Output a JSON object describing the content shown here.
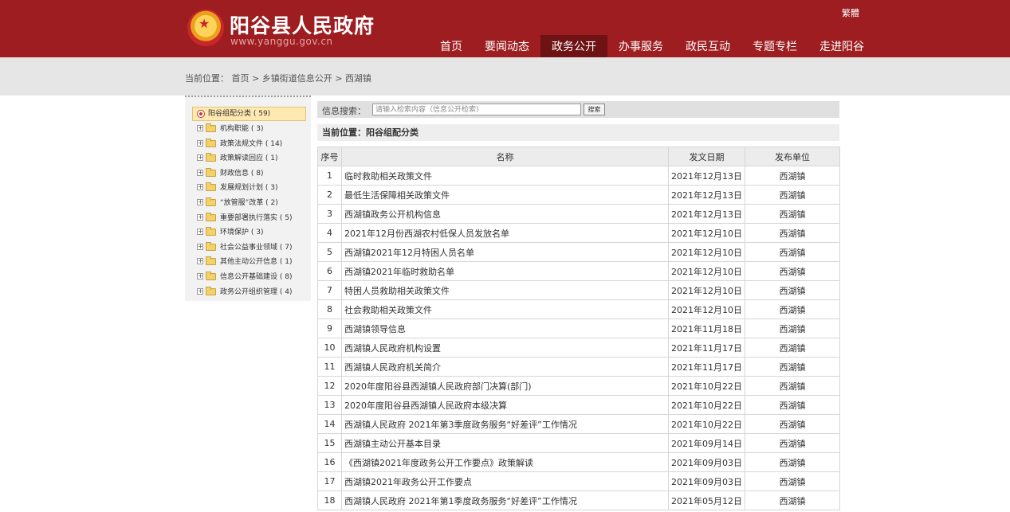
{
  "header": {
    "site_title": "阳谷县人民政府",
    "site_url": "www.yanggu.gov.cn",
    "traditional_link": "繁體",
    "nav": [
      {
        "label": "首页"
      },
      {
        "label": "要闻动态"
      },
      {
        "label": "政务公开",
        "active": true
      },
      {
        "label": "办事服务"
      },
      {
        "label": "政民互动"
      },
      {
        "label": "专题专栏"
      },
      {
        "label": "走进阳谷"
      }
    ]
  },
  "breadcrumb": {
    "prefix": "当前位置：",
    "items": [
      "首页",
      "乡镇街道信息公开",
      "西湖镇"
    ],
    "separator": " > "
  },
  "sidebar": {
    "root": "阳谷组配分类 ( 59)",
    "items": [
      {
        "label": "机构职能 ( 3)"
      },
      {
        "label": "政策法规文件 ( 14)"
      },
      {
        "label": "政策解读回应 ( 1)"
      },
      {
        "label": "财政信息 ( 8)"
      },
      {
        "label": "发展规划计划 ( 3)"
      },
      {
        "label": "“放管服”改革 ( 2)"
      },
      {
        "label": "重要部署执行落实 ( 5)"
      },
      {
        "label": "环境保护 ( 3)"
      },
      {
        "label": "社会公益事业领域 ( 7)"
      },
      {
        "label": "其他主动公开信息 ( 1)"
      },
      {
        "label": "信息公开基础建设 ( 8)"
      },
      {
        "label": "政务公开组织管理 ( 4)"
      }
    ]
  },
  "search": {
    "label": "信息搜索：",
    "placeholder": "请输入检索内容（信息公开检索)",
    "value": "",
    "button_label": "搜索"
  },
  "current_position": "当前位置：阳谷组配分类",
  "table": {
    "headers": [
      "序号",
      "名称",
      "发文日期",
      "发布单位"
    ],
    "rows": [
      {
        "num": "1",
        "title": "临时救助相关政策文件",
        "date": "2021年12月13日",
        "unit": "西湖镇"
      },
      {
        "num": "2",
        "title": "最低生活保障相关政策文件",
        "date": "2021年12月13日",
        "unit": "西湖镇"
      },
      {
        "num": "3",
        "title": "西湖镇政务公开机构信息",
        "date": "2021年12月13日",
        "unit": "西湖镇"
      },
      {
        "num": "4",
        "title": "2021年12月份西湖农村低保人员发放名单",
        "date": "2021年12月10日",
        "unit": "西湖镇"
      },
      {
        "num": "5",
        "title": "西湖镇2021年12月特困人员名单",
        "date": "2021年12月10日",
        "unit": "西湖镇"
      },
      {
        "num": "6",
        "title": "西湖镇2021年临时救助名单",
        "date": "2021年12月10日",
        "unit": "西湖镇"
      },
      {
        "num": "7",
        "title": "特困人员救助相关政策文件",
        "date": "2021年12月10日",
        "unit": "西湖镇"
      },
      {
        "num": "8",
        "title": "社会救助相关政策文件",
        "date": "2021年12月10日",
        "unit": "西湖镇"
      },
      {
        "num": "9",
        "title": "西湖镇领导信息",
        "date": "2021年11月18日",
        "unit": "西湖镇"
      },
      {
        "num": "10",
        "title": "西湖镇人民政府机构设置",
        "date": "2021年11月17日",
        "unit": "西湖镇"
      },
      {
        "num": "11",
        "title": "西湖镇人民政府机关简介",
        "date": "2021年11月17日",
        "unit": "西湖镇"
      },
      {
        "num": "12",
        "title": "2020年度阳谷县西湖镇人民政府部门决算(部门)",
        "date": "2021年10月22日",
        "unit": "西湖镇"
      },
      {
        "num": "13",
        "title": "2020年度阳谷县西湖镇人民政府本级决算",
        "date": "2021年10月22日",
        "unit": "西湖镇"
      },
      {
        "num": "14",
        "title": "西湖镇人民政府 2021年第3季度政务服务“好差评”工作情况",
        "date": "2021年10月22日",
        "unit": "西湖镇"
      },
      {
        "num": "15",
        "title": "西湖镇主动公开基本目录",
        "date": "2021年09月14日",
        "unit": "西湖镇"
      },
      {
        "num": "16",
        "title": "《西湖镇2021年度政务公开工作要点》政策解读",
        "date": "2021年09月03日",
        "unit": "西湖镇"
      },
      {
        "num": "17",
        "title": "西湖镇2021年政务公开工作要点",
        "date": "2021年09月03日",
        "unit": "西湖镇"
      },
      {
        "num": "18",
        "title": "西湖镇人民政府 2021年第1季度政务服务“好差评”工作情况",
        "date": "2021年05月12日",
        "unit": "西湖镇"
      }
    ]
  }
}
